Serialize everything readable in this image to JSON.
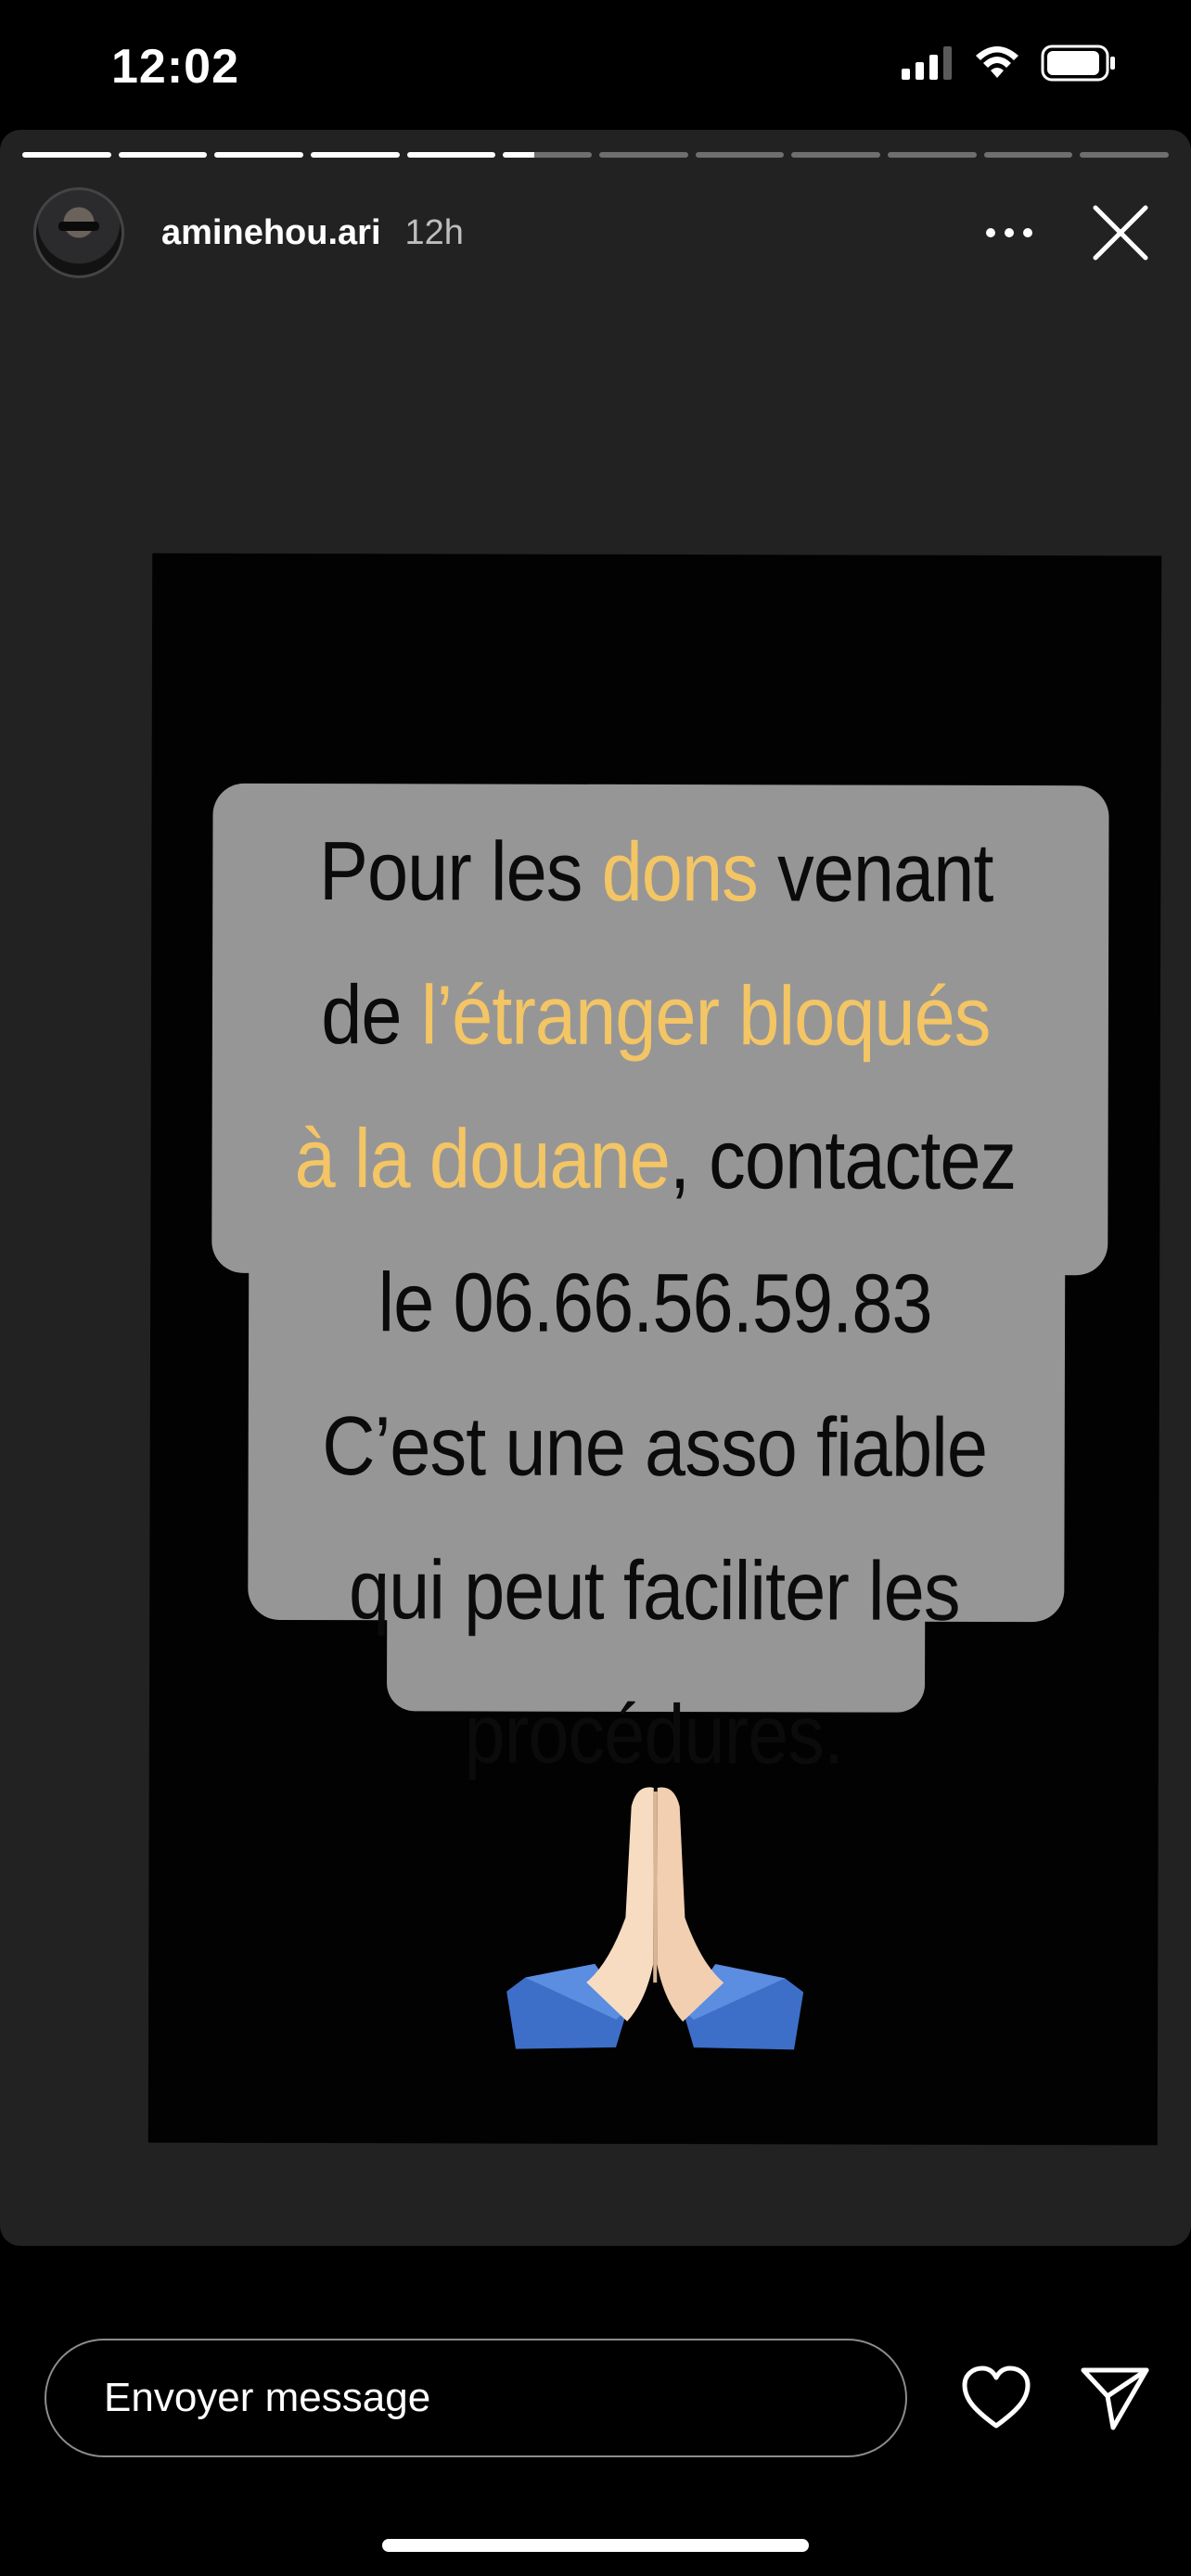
{
  "status_bar": {
    "time": "12:02",
    "icons": [
      "signal-icon",
      "wifi-icon",
      "battery-icon"
    ]
  },
  "story": {
    "segments_total": 12,
    "segments_completed": 5,
    "current_segment_progress": 0.35,
    "username": "aminehou.ari",
    "time_ago": "12h",
    "header_icons": [
      "more-options-icon",
      "close-icon"
    ],
    "text_lines": [
      [
        {
          "t": "Pour les ",
          "h": false
        },
        {
          "t": "dons",
          "h": true
        },
        {
          "t": " venant",
          "h": false
        }
      ],
      [
        {
          "t": "de ",
          "h": false
        },
        {
          "t": "l’étranger bloqués",
          "h": true
        }
      ],
      [
        {
          "t": "à la douane",
          "h": true
        },
        {
          "t": ", contactez",
          "h": false
        }
      ],
      [
        {
          "t": "le 06.66.56.59.83",
          "h": false
        }
      ],
      [
        {
          "t": "C’est une asso fiable",
          "h": false
        }
      ],
      [
        {
          "t": "qui peut faciliter les",
          "h": false
        }
      ],
      [
        {
          "t": "procédures.",
          "h": false
        }
      ]
    ],
    "emoji": "praying-hands-icon"
  },
  "reply_bar": {
    "placeholder": "Envoyer message",
    "icons": [
      "heart-icon",
      "send-icon"
    ]
  },
  "colors": {
    "background": "#000000",
    "card": "#222223",
    "bubble": "#969696",
    "highlight": "#f3c565",
    "text_dark": "#0b0b0b"
  }
}
